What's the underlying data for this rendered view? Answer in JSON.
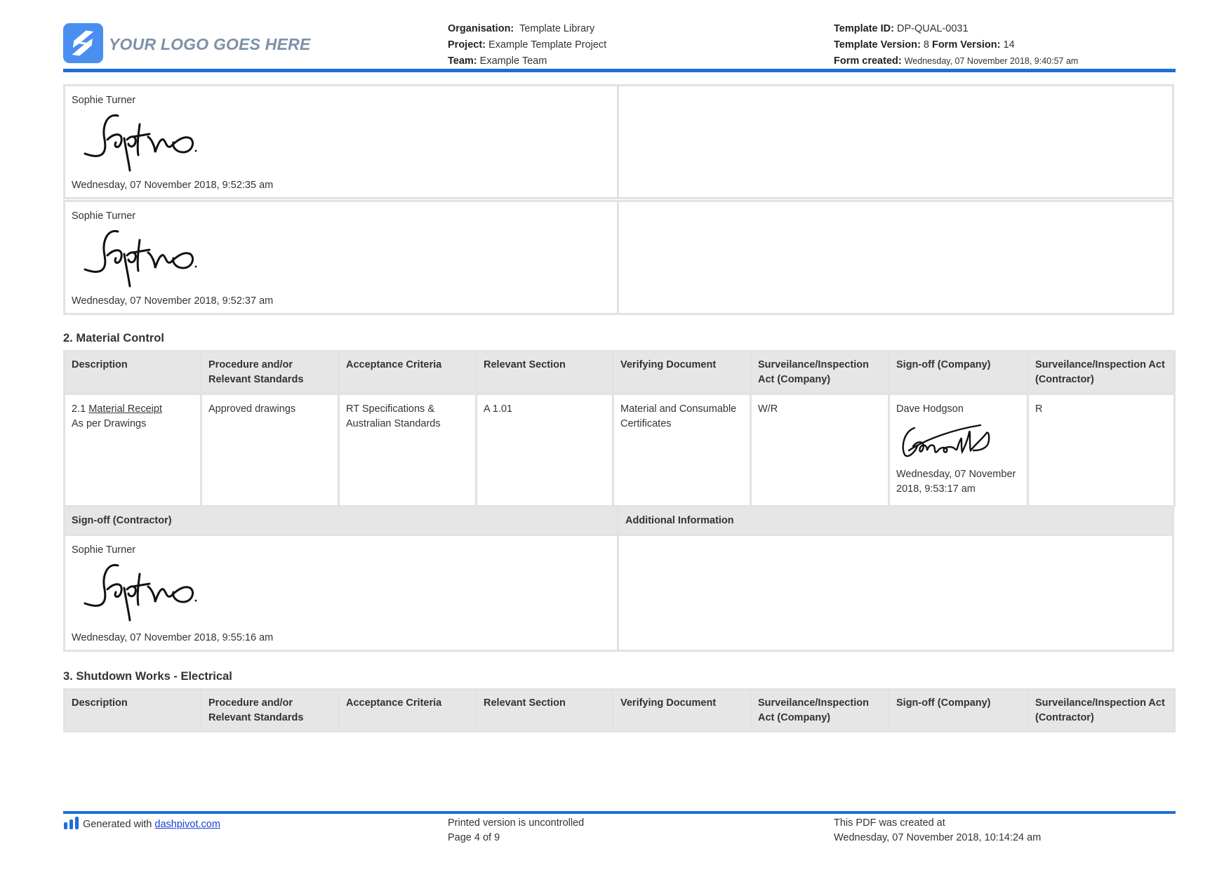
{
  "header": {
    "logo_text": "YOUR LOGO GOES HERE",
    "organisation_label": "Organisation:",
    "organisation_value": "Template Library",
    "project_label": "Project:",
    "project_value": "Example Template Project",
    "team_label": "Team:",
    "team_value": "Example Team",
    "template_id_label": "Template ID:",
    "template_id_value": "DP-QUAL-0031",
    "template_version_label": "Template Version:",
    "template_version_value": "8",
    "form_version_label": "Form Version:",
    "form_version_value": "14",
    "form_created_label": "Form created:",
    "form_created_value": "Wednesday, 07 November 2018, 9:40:57 am"
  },
  "signoffs_top": [
    {
      "name": "Sophie Turner",
      "date": "Wednesday, 07 November 2018, 9:52:35 am"
    },
    {
      "name": "Sophie Turner",
      "date": "Wednesday, 07 November 2018, 9:52:37 am"
    }
  ],
  "section2": {
    "title": "2. Material Control",
    "headers": [
      "Description",
      "Procedure and/or Relevant Standards",
      "Acceptance Criteria",
      "Relevant Section",
      "Verifying Document",
      "Surveilance/Inspection Act (Company)",
      "Sign-off (Company)",
      "Surveilance/Inspection Act (Contractor)"
    ],
    "row": {
      "desc_number": "2.1",
      "desc_link": "Material Receipt",
      "desc_rest": "As per Drawings",
      "procedure": "Approved drawings",
      "acceptance": "RT Specifications & Australian Standards",
      "relevant_section": "A 1.01",
      "verifying_document": "Material and Consumable Certificates",
      "inspection_company": "W/R",
      "signoff_company_name": "Dave Hodgson",
      "signoff_company_date": "Wednesday, 07 November 2018, 9:53:17 am",
      "inspection_contractor": "R"
    },
    "signoff_contractor_label": "Sign-off (Contractor)",
    "additional_info_label": "Additional Information",
    "signoff_contractor": {
      "name": "Sophie Turner",
      "date": "Wednesday, 07 November 2018, 9:55:16 am"
    }
  },
  "section3": {
    "title": "3. Shutdown Works - Electrical",
    "headers": [
      "Description",
      "Procedure and/or Relevant Standards",
      "Acceptance Criteria",
      "Relevant Section",
      "Verifying Document",
      "Surveilance/Inspection Act (Company)",
      "Sign-off (Company)",
      "Surveilance/Inspection Act (Contractor)"
    ]
  },
  "footer": {
    "generated_with": "Generated with",
    "link_text": "dashpivot.com",
    "uncontrolled": "Printed version is uncontrolled",
    "page": "Page 4 of 9",
    "created_label": "This PDF was created at",
    "created_value": "Wednesday, 07 November 2018, 10:14:24 am"
  },
  "colors": {
    "accent": "#1e6fd9",
    "logo": "#4a8ff0",
    "header_gray": "#e6e6e6",
    "border": "#e2e2e2"
  },
  "icons": [
    "logo-icon",
    "signature-image",
    "dashpivot-bars-icon"
  ]
}
